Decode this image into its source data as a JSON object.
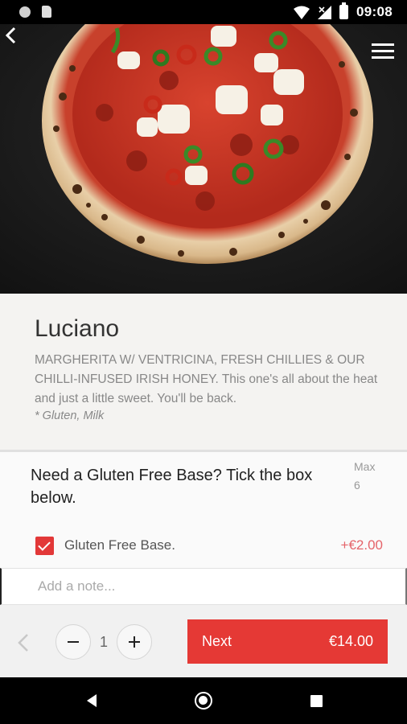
{
  "status_bar": {
    "time": "09:08",
    "icons": [
      "circle-notification-icon",
      "sd-card-icon",
      "wifi-icon",
      "signal-icon",
      "battery-icon"
    ]
  },
  "header": {
    "back_icon": "chevron-left-icon",
    "menu_icon": "hamburger-menu-icon"
  },
  "product": {
    "name": "Luciano",
    "description": "MARGHERITA W/ VENTRICINA, FRESH CHILLIES & OUR CHILLI-INFUSED IRISH HONEY. This one's all about the heat and just a little sweet. You'll be back.",
    "allergens": "* Gluten, Milk"
  },
  "option_group": {
    "title": "Need a Gluten Free Base? Tick the box below.",
    "max_label": "Max",
    "max_value": "6",
    "options": [
      {
        "label": "Gluten Free Base.",
        "price": "+€2.00",
        "checked": true
      }
    ]
  },
  "note": {
    "placeholder": "Add a note..."
  },
  "footer": {
    "quantity": "1",
    "next_label": "Next",
    "next_price": "€14.00"
  },
  "colors": {
    "accent": "#e53935",
    "price_text": "#e5646a"
  }
}
